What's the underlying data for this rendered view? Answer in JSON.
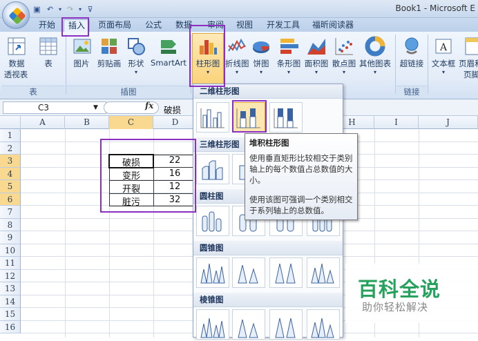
{
  "window": {
    "title": "Book1 - Microsoft E"
  },
  "tabs": [
    "开始",
    "插入",
    "页面布局",
    "公式",
    "数据",
    "审阅",
    "视图",
    "开发工具",
    "福昕阅读器"
  ],
  "ribbon": {
    "buttons": {
      "pivot_top": "数据",
      "pivot_bottom": "透视表",
      "table": "表",
      "picture": "图片",
      "clipart": "剪贴画",
      "shapes": "形状",
      "smartart": "SmartArt",
      "column": "柱形图",
      "line": "折线图",
      "pie": "饼图",
      "bar": "条形图",
      "area": "面积图",
      "scatter": "散点图",
      "other": "其他图表",
      "hyperlink": "超链接",
      "textbox": "文本框",
      "header_top": "页眉和",
      "header_bottom": "页脚"
    },
    "groups": {
      "tables": "表",
      "illustrations": "插图",
      "links": "链接"
    }
  },
  "formula_bar": {
    "cell_ref": "C3",
    "fx": "fx",
    "value": "破损"
  },
  "columns": [
    "A",
    "B",
    "C",
    "D",
    "E",
    "F",
    "G",
    "H",
    "I",
    "J"
  ],
  "rows": [
    "1",
    "2",
    "3",
    "4",
    "5",
    "6",
    "7",
    "8",
    "9",
    "10",
    "11",
    "12",
    "13",
    "14",
    "15",
    "16"
  ],
  "table": [
    [
      "破损",
      "22"
    ],
    [
      "变形",
      "16"
    ],
    [
      "开裂",
      "12"
    ],
    [
      "脏污",
      "32"
    ]
  ],
  "dropdown": {
    "sections": [
      "二维柱形图",
      "三维柱形图",
      "圆柱图",
      "圆锥图",
      "棱锥图"
    ]
  },
  "tooltip": {
    "title": "堆积柱形图",
    "p1": "使用垂直矩形比较相交于类别轴上的每个数值占总数值的大小。",
    "p2": "使用该图可强调一个类别相交于系列轴上的总数值。"
  },
  "watermark": {
    "title": "百科全说",
    "subtitle": "助你轻松解决"
  },
  "colors": {
    "highlight": "#8a2fc0",
    "watermark": "#27a25d"
  }
}
